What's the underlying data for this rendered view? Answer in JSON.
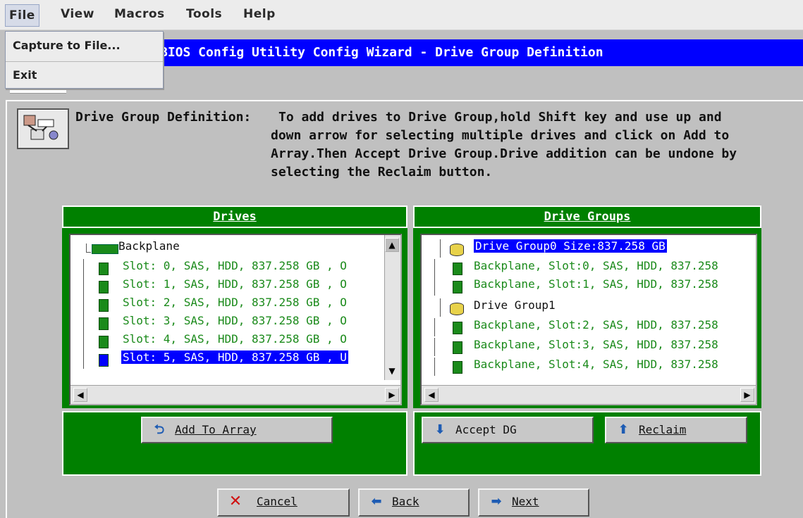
{
  "menubar": {
    "file": "File",
    "view": "View",
    "macros": "Macros",
    "tools": "Tools",
    "help": "Help"
  },
  "file_menu": {
    "items": [
      "Capture to File...",
      "Exit"
    ]
  },
  "window_title": "BIOS Config Utility  Config Wizard - Drive Group Definition",
  "info": {
    "label": "Drive Group Definition:",
    "lines": [
      "To add drives to Drive Group,hold Shift key and use up and",
      "down arrow for selecting multiple drives and click on Add to",
      "Array.Then Accept Drive Group.Drive addition can be undone by",
      "selecting the Reclaim button."
    ]
  },
  "drives_panel": {
    "title": "Drives",
    "root": "Backplane",
    "items": [
      "Slot: 0, SAS, HDD, 837.258 GB , O",
      "Slot: 1, SAS, HDD, 837.258 GB , O",
      "Slot: 2, SAS, HDD, 837.258 GB , O",
      "Slot: 3, SAS, HDD, 837.258 GB , O",
      "Slot: 4, SAS, HDD, 837.258 GB , O",
      "Slot: 5, SAS, HDD, 837.258 GB , U"
    ],
    "selected_index": 5
  },
  "groups_panel": {
    "title": "Drive Groups",
    "items": [
      {
        "text": "Drive Group0 Size:837.258 GB",
        "type": "group"
      },
      {
        "text": "Backplane, Slot:0, SAS, HDD, 837.258",
        "type": "drive"
      },
      {
        "text": "Backplane, Slot:1, SAS, HDD, 837.258",
        "type": "drive"
      },
      {
        "text": "Drive Group1",
        "type": "group"
      },
      {
        "text": "Backplane, Slot:2, SAS, HDD, 837.258",
        "type": "drive"
      },
      {
        "text": "Backplane, Slot:3, SAS, HDD, 837.258",
        "type": "drive"
      },
      {
        "text": "Backplane, Slot:4, SAS, HDD, 837.258",
        "type": "drive"
      }
    ]
  },
  "buttons": {
    "add_to_array": "Add To Array",
    "accept_dg": "Accept DG",
    "reclaim": "Reclaim",
    "cancel": "Cancel",
    "back": "Back",
    "next": "Next"
  },
  "colors": {
    "panel_green": "#008000",
    "title_blue": "#0000ff",
    "text_green": "#1a8a1a"
  }
}
